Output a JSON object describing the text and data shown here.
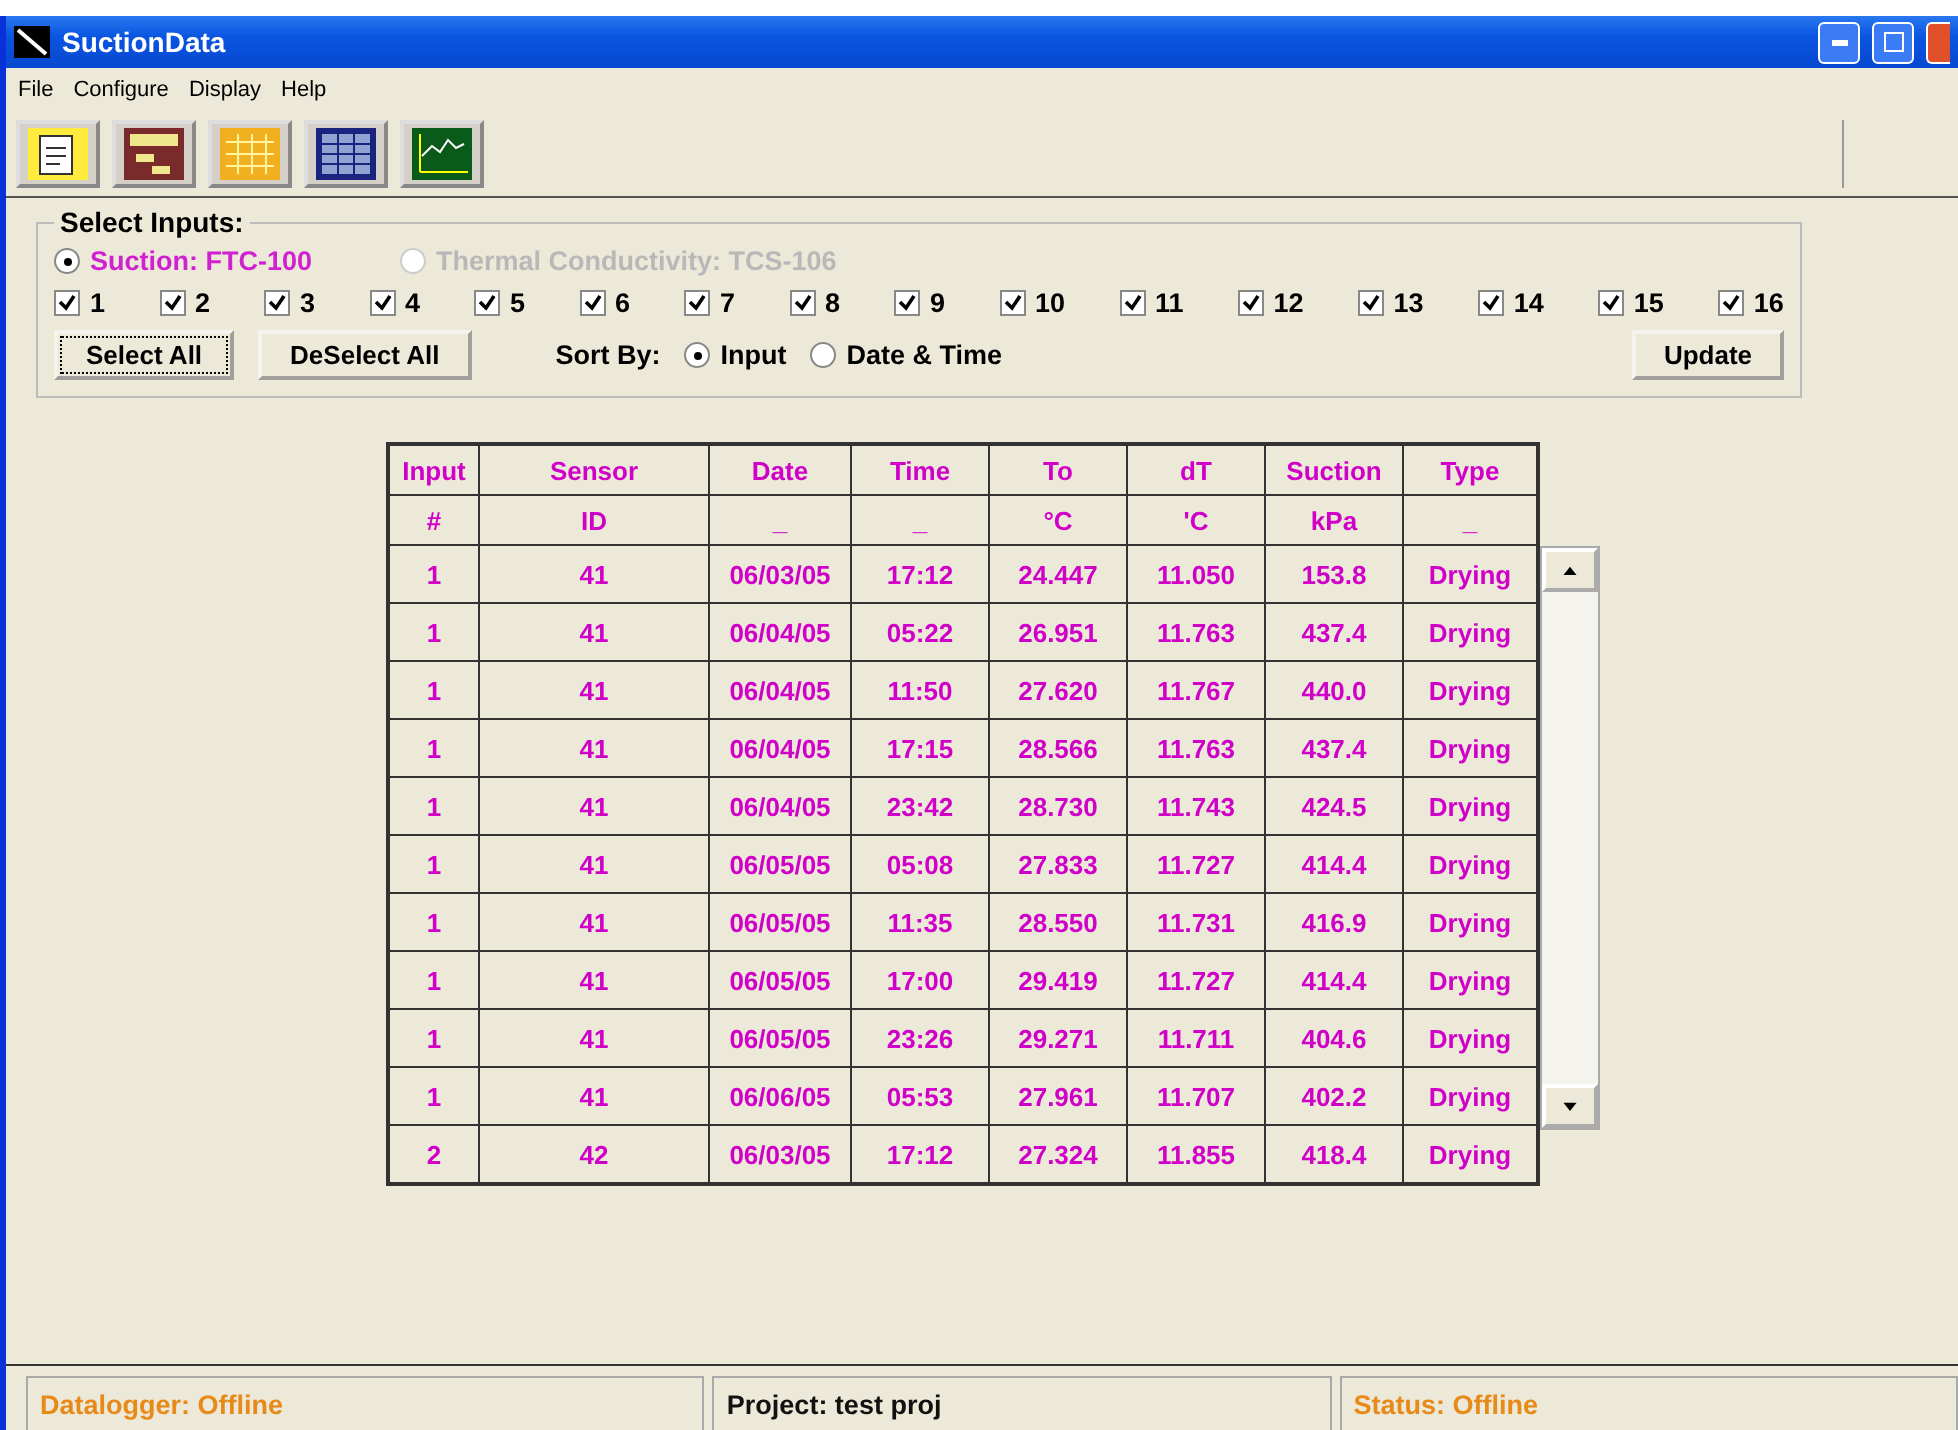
{
  "window": {
    "title": "SuctionData"
  },
  "menu": [
    "File",
    "Configure",
    "Display",
    "Help"
  ],
  "select_inputs": {
    "title": "Select Inputs:",
    "sensor_types": [
      {
        "label": "Suction: FTC-100",
        "selected": true,
        "disabled": false
      },
      {
        "label": "Thermal Conductivity: TCS-106",
        "selected": false,
        "disabled": true
      }
    ],
    "inputs": [
      {
        "label": "1",
        "checked": true
      },
      {
        "label": "2",
        "checked": true
      },
      {
        "label": "3",
        "checked": true
      },
      {
        "label": "4",
        "checked": true
      },
      {
        "label": "5",
        "checked": true
      },
      {
        "label": "6",
        "checked": true
      },
      {
        "label": "7",
        "checked": true
      },
      {
        "label": "8",
        "checked": true
      },
      {
        "label": "9",
        "checked": true
      },
      {
        "label": "10",
        "checked": true
      },
      {
        "label": "11",
        "checked": true
      },
      {
        "label": "12",
        "checked": true
      },
      {
        "label": "13",
        "checked": true
      },
      {
        "label": "14",
        "checked": true
      },
      {
        "label": "15",
        "checked": true
      },
      {
        "label": "16",
        "checked": true
      }
    ],
    "select_all": "Select All",
    "deselect_all": "DeSelect All",
    "sort_by": {
      "label": "Sort By:",
      "options": [
        {
          "label": "Input",
          "selected": true
        },
        {
          "label": "Date & Time",
          "selected": false
        }
      ]
    },
    "update": "Update"
  },
  "table": {
    "columns": [
      {
        "name": "Input",
        "unit": "#"
      },
      {
        "name": "Sensor",
        "unit": "ID"
      },
      {
        "name": "Date",
        "unit": "_"
      },
      {
        "name": "Time",
        "unit": "_"
      },
      {
        "name": "To",
        "unit": "°C"
      },
      {
        "name": "dT",
        "unit": "'C"
      },
      {
        "name": "Suction",
        "unit": "kPa"
      },
      {
        "name": "Type",
        "unit": "_"
      }
    ],
    "rows": [
      [
        "1",
        "41",
        "06/03/05",
        "17:12",
        "24.447",
        "11.050",
        "153.8",
        "Drying"
      ],
      [
        "1",
        "41",
        "06/04/05",
        "05:22",
        "26.951",
        "11.763",
        "437.4",
        "Drying"
      ],
      [
        "1",
        "41",
        "06/04/05",
        "11:50",
        "27.620",
        "11.767",
        "440.0",
        "Drying"
      ],
      [
        "1",
        "41",
        "06/04/05",
        "17:15",
        "28.566",
        "11.763",
        "437.4",
        "Drying"
      ],
      [
        "1",
        "41",
        "06/04/05",
        "23:42",
        "28.730",
        "11.743",
        "424.5",
        "Drying"
      ],
      [
        "1",
        "41",
        "06/05/05",
        "05:08",
        "27.833",
        "11.727",
        "414.4",
        "Drying"
      ],
      [
        "1",
        "41",
        "06/05/05",
        "11:35",
        "28.550",
        "11.731",
        "416.9",
        "Drying"
      ],
      [
        "1",
        "41",
        "06/05/05",
        "17:00",
        "29.419",
        "11.727",
        "414.4",
        "Drying"
      ],
      [
        "1",
        "41",
        "06/05/05",
        "23:26",
        "29.271",
        "11.711",
        "404.6",
        "Drying"
      ],
      [
        "1",
        "41",
        "06/06/05",
        "05:53",
        "27.961",
        "11.707",
        "402.2",
        "Drying"
      ],
      [
        "2",
        "42",
        "06/03/05",
        "17:12",
        "27.324",
        "11.855",
        "418.4",
        "Drying"
      ]
    ]
  },
  "status_bar": [
    {
      "text": "Datalogger: Offline",
      "kind": "alert"
    },
    {
      "text": "Project: test proj",
      "kind": "plain"
    },
    {
      "text": "Status: Offline",
      "kind": "alert"
    }
  ]
}
